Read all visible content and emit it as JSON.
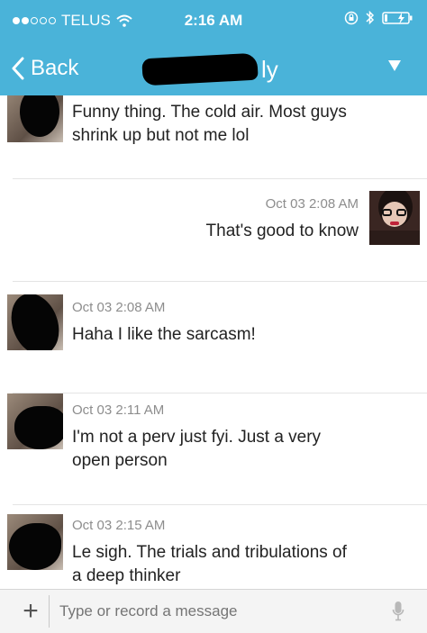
{
  "status_bar": {
    "carrier": "TELUS",
    "time": "2:16 AM"
  },
  "nav": {
    "back_label": "Back",
    "title_visible_suffix": "ly"
  },
  "messages": [
    {
      "sender": "other",
      "timestamp": "",
      "lines": [
        "Funny thing. The cold air. Most guys",
        "shrink up but not me lol"
      ]
    },
    {
      "sender": "me",
      "timestamp": "Oct 03 2:08 AM",
      "lines": [
        "That's good to know"
      ]
    },
    {
      "sender": "other",
      "timestamp": "Oct 03 2:08 AM",
      "lines": [
        "Haha I like the sarcasm!"
      ]
    },
    {
      "sender": "other",
      "timestamp": "Oct 03 2:11 AM",
      "lines": [
        "I'm not a perv just fyi. Just a very",
        "open person"
      ]
    },
    {
      "sender": "other",
      "timestamp": "Oct 03 2:15 AM",
      "lines": [
        "Le sigh. The trials and tribulations of",
        "a deep thinker"
      ]
    }
  ],
  "input": {
    "placeholder": "Type or record a message",
    "plus_label": "+"
  },
  "colors": {
    "header": "#4ab3d9",
    "timestamp": "#8d8d8d",
    "divider": "#e4e4e4"
  },
  "icons": [
    "wifi-icon",
    "orientation-lock-icon",
    "bluetooth-icon",
    "battery-charging-icon",
    "chevron-left-icon",
    "dropdown-triangle-icon",
    "microphone-icon"
  ]
}
